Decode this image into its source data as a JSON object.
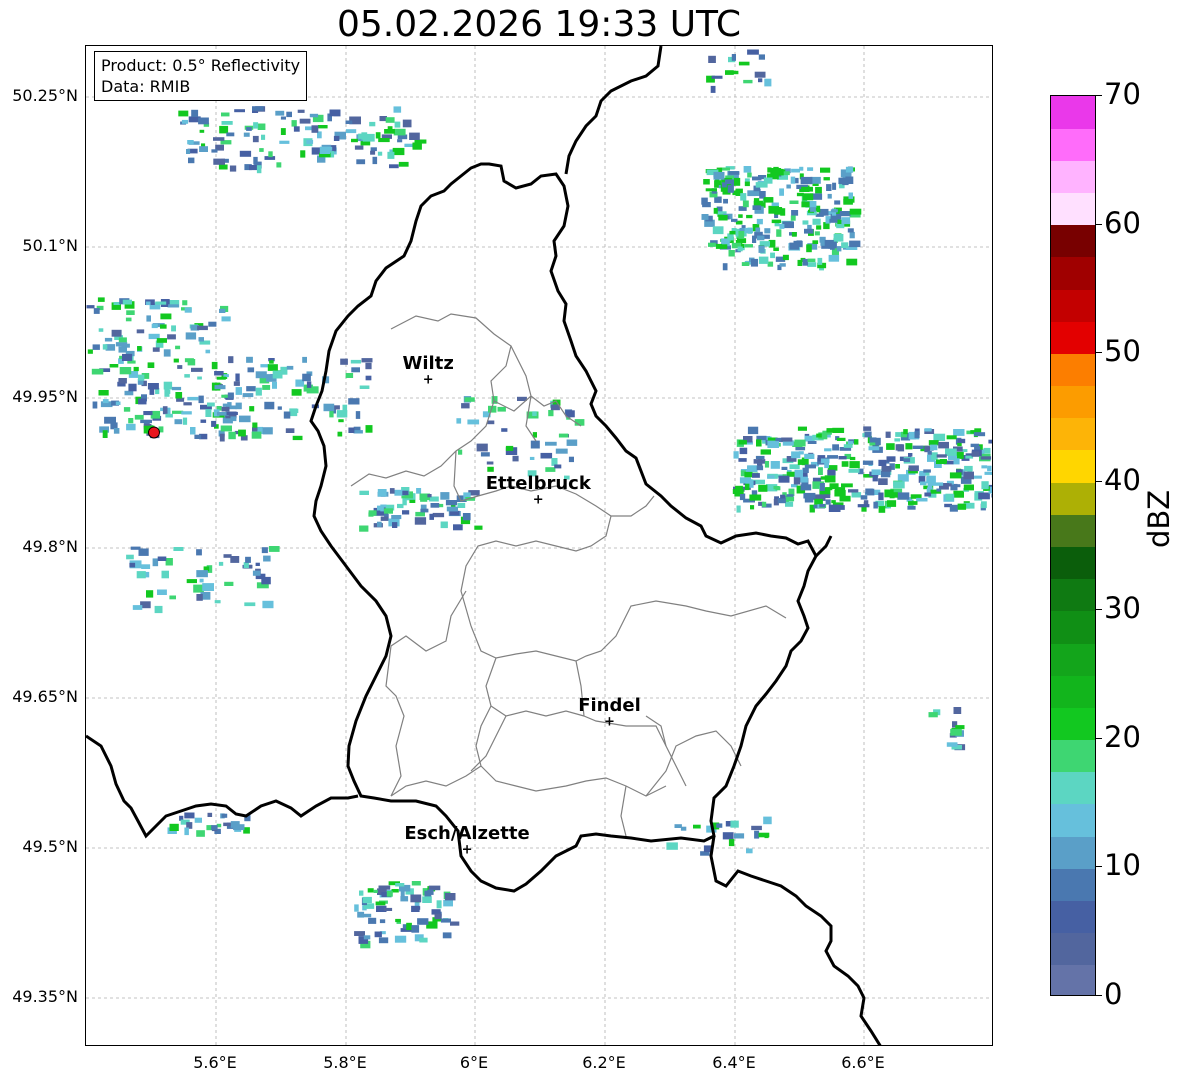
{
  "title": "05.02.2026 19:33 UTC",
  "info_box": {
    "product": "Product: 0.5° Reflectivity",
    "data": "Data: RMIB"
  },
  "lat_ticks": [
    "50.25°N",
    "50.1°N",
    "49.95°N",
    "49.8°N",
    "49.65°N",
    "49.5°N",
    "49.35°N"
  ],
  "lon_ticks": [
    "5.6°E",
    "5.8°E",
    "6°E",
    "6.2°E",
    "6.4°E",
    "6.6°E"
  ],
  "cities": [
    {
      "name": "Wiltz",
      "lon": 5.93,
      "lat": 49.966
    },
    {
      "name": "Ettelbruck",
      "lon": 6.1,
      "lat": 49.847
    },
    {
      "name": "Findel",
      "lon": 6.21,
      "lat": 49.625
    },
    {
      "name": "Esch/Alzette",
      "lon": 5.99,
      "lat": 49.497
    }
  ],
  "radar_site": {
    "lon": 5.505,
    "lat": 49.915,
    "color": "#e8141e"
  },
  "colorbar": {
    "label": "dBZ",
    "ticks": [
      "0",
      "10",
      "20",
      "30",
      "40",
      "50",
      "60",
      "70"
    ],
    "colors": [
      "#6473a8",
      "#52669e",
      "#4660a3",
      "#4a78b0",
      "#5a9fc8",
      "#66c0dc",
      "#5cd6c2",
      "#3ed672",
      "#12c820",
      "#12b51c",
      "#13a51b",
      "#108f15",
      "#0f7a12",
      "#0b5e0b",
      "#48781a",
      "#adb005",
      "#ffd600",
      "#fdb407",
      "#fc9c00",
      "#fc7e00",
      "#e30000",
      "#c30000",
      "#a00000",
      "#780000",
      "#ffe0ff",
      "#ffb3ff",
      "#ff6cfa",
      "#ea38ea"
    ]
  }
}
